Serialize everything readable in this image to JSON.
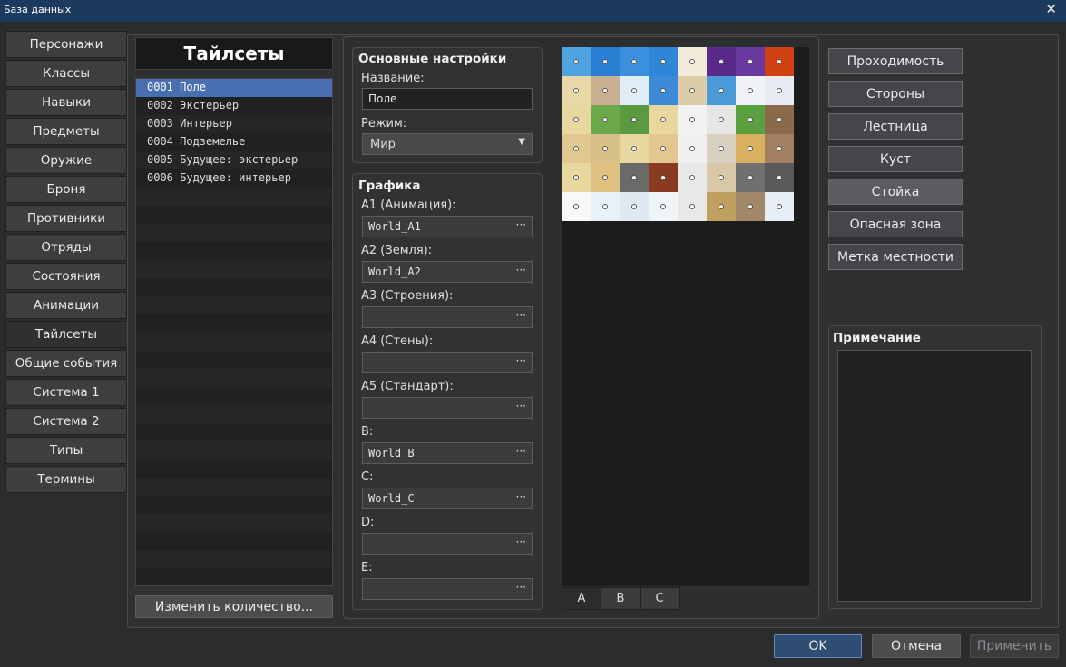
{
  "window": {
    "title": "База данных"
  },
  "nav": {
    "items": [
      {
        "label": "Персонажи"
      },
      {
        "label": "Классы"
      },
      {
        "label": "Навыки"
      },
      {
        "label": "Предметы"
      },
      {
        "label": "Оружие"
      },
      {
        "label": "Броня"
      },
      {
        "label": "Противники"
      },
      {
        "label": "Отряды"
      },
      {
        "label": "Состояния"
      },
      {
        "label": "Анимации"
      },
      {
        "label": "Тайлсеты"
      },
      {
        "label": "Общие события"
      },
      {
        "label": "Система 1"
      },
      {
        "label": "Система 2"
      },
      {
        "label": "Типы"
      },
      {
        "label": "Термины"
      }
    ],
    "active": "Тайлсеты"
  },
  "list": {
    "title": "Тайлсеты",
    "rows": [
      "0001 Поле",
      "0002 Экстерьер",
      "0003 Интерьер",
      "0004 Подземелье",
      "0005 Будущее: экстерьер",
      "0006 Будущее: интерьер"
    ],
    "selected_index": 0,
    "change_max_label": "Изменить количество..."
  },
  "general": {
    "title": "Основные настройки",
    "name_label": "Название:",
    "name_value": "Поле",
    "mode_label": "Режим:",
    "mode_value": "Мир"
  },
  "graphics": {
    "title": "Графика",
    "fields": [
      {
        "label": "A1 (Анимация):",
        "value": "World_A1"
      },
      {
        "label": "A2 (Земля):",
        "value": "World_A2"
      },
      {
        "label": "A3 (Строения):",
        "value": ""
      },
      {
        "label": "A4 (Стены):",
        "value": ""
      },
      {
        "label": "A5 (Стандарт):",
        "value": ""
      },
      {
        "label": "B:",
        "value": "World_B"
      },
      {
        "label": "C:",
        "value": "World_C"
      },
      {
        "label": "D:",
        "value": ""
      },
      {
        "label": "E:",
        "value": ""
      }
    ],
    "browse_glyph": "···"
  },
  "tiles": {
    "tabs": [
      "A",
      "B",
      "C"
    ],
    "active_tab": "A"
  },
  "modes": {
    "buttons": [
      "Проходимость",
      "Стороны",
      "Лестница",
      "Куст",
      "Стойка",
      "Опасная зона",
      "Метка местности"
    ],
    "selected": "Стойка"
  },
  "note": {
    "title": "Примечание",
    "value": ""
  },
  "footer": {
    "ok": "OK",
    "cancel": "Отмена",
    "apply": "Применить"
  }
}
